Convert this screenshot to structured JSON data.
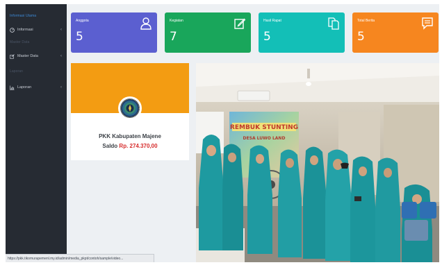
{
  "sidebar": {
    "heading_main": "Informasi Utama",
    "items": [
      {
        "label": "Informasi",
        "icon": "gauge-icon"
      },
      {
        "label": "Master Data",
        "icon": "edit-icon"
      },
      {
        "label": "Laporan",
        "icon": "bar-chart-icon"
      }
    ],
    "heading_master": "Master Data",
    "heading_laporan": "Laporan"
  },
  "stats": [
    {
      "label": "Anggota",
      "value": "5",
      "icon": "user-icon",
      "color": "#5b5fd0"
    },
    {
      "label": "Kegiatan",
      "value": "7",
      "icon": "edit-icon",
      "color": "#19a65b"
    },
    {
      "label": "Hasil Rapat",
      "value": "5",
      "icon": "copy-icon",
      "color": "#13bfb7"
    },
    {
      "label": "Total Berita",
      "value": "5",
      "icon": "comment-icon",
      "color": "#f6861f"
    }
  ],
  "profile": {
    "name": "PKK Kabupaten Majene",
    "saldo_label": "Saldo",
    "saldo_value": "Rp. 274.370,00",
    "band_color": "#f39c12"
  },
  "photo": {
    "banner_line1": "REMBUK STUNTING",
    "banner_line2": "DESA LUWO LAND",
    "icon": "photo-icon"
  },
  "status_bar": {
    "url": "https://pkk.tikomurapemenl.my.id/admin/media_pkpt/contoh/sample/video..."
  }
}
